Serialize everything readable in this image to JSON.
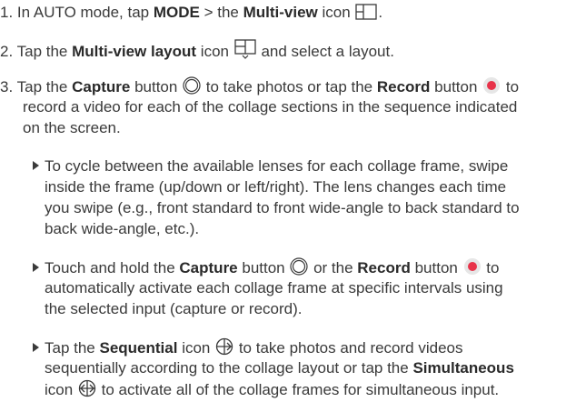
{
  "steps": [
    {
      "num": "1.",
      "a": "In AUTO mode, tap ",
      "b": "MODE",
      "c": " > the ",
      "d": "Multi-view",
      "e": " icon ",
      "f": "."
    },
    {
      "num": "2.",
      "a": "Tap the ",
      "b": "Multi-view layout",
      "c": " icon ",
      "d": " and select a layout."
    },
    {
      "num": "3.",
      "a": "Tap the ",
      "b": "Capture",
      "c": " button ",
      "d": " to take photos or tap the ",
      "e": "Record",
      "f": " button ",
      "g": " to",
      "l2": "record a video for each of the collage sections in the sequence indicated",
      "l3": "on the screen."
    }
  ],
  "bullets": [
    {
      "l1": "To cycle between the available lenses for each collage frame, swipe",
      "l2": "inside the frame (up/down or left/right). The lens changes each time",
      "l3": "you swipe (e.g., front standard to front wide-angle to back standard to",
      "l4": "back wide-angle, etc.)."
    },
    {
      "a": "Touch and hold the ",
      "b": "Capture",
      "c": " button ",
      "d": " or the ",
      "e": "Record",
      "f": " button ",
      "g": " to",
      "l2": "automatically activate each collage frame at specific intervals using",
      "l3": "the selected input (capture or record)."
    },
    {
      "a": "Tap the ",
      "b": "Sequential",
      "c": " icon ",
      "d": " to take photos and record videos",
      "l2": "sequentially according to the collage layout or tap the ",
      "l2b": "Simultaneous",
      "l3a": "icon ",
      "l3b": " to activate all of the collage frames for simultaneous input."
    }
  ],
  "icons": {
    "record_color": "#e8334a"
  }
}
